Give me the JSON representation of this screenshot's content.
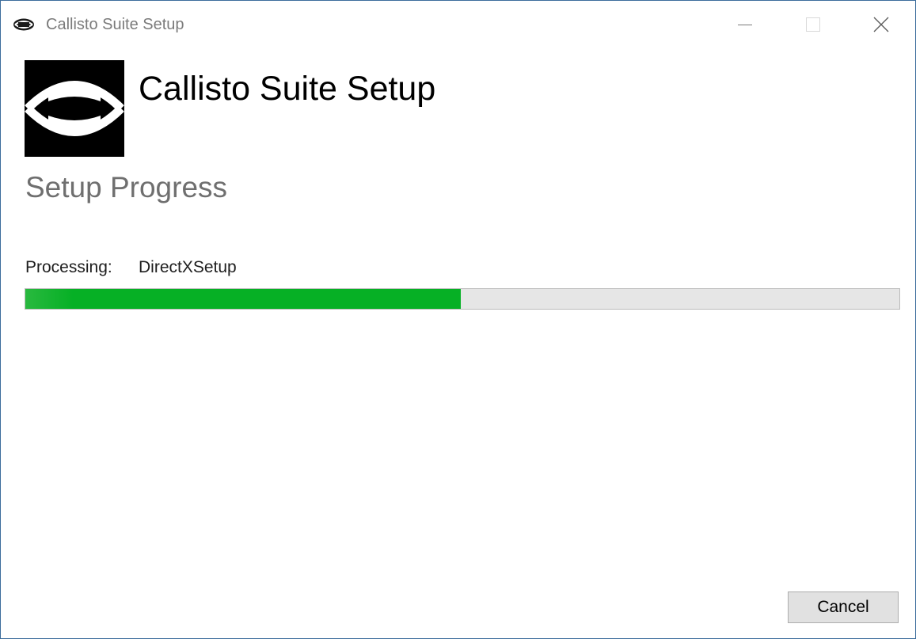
{
  "window": {
    "title": "Callisto Suite Setup",
    "controls": {
      "minimize": "minimize-icon",
      "maximize": "maximize-icon",
      "close": "close-icon"
    }
  },
  "header": {
    "logo": "callisto-logo",
    "title": "Callisto Suite Setup"
  },
  "page": {
    "section_title": "Setup Progress",
    "processing_label": "Processing:",
    "processing_value": "DirectXSetup",
    "progress_fraction": 0.498
  },
  "buttons": {
    "cancel_label": "Cancel"
  },
  "colors": {
    "progress_fill": "#06b025",
    "progress_track": "#e6e6e6",
    "window_border": "#3c6d9c"
  }
}
